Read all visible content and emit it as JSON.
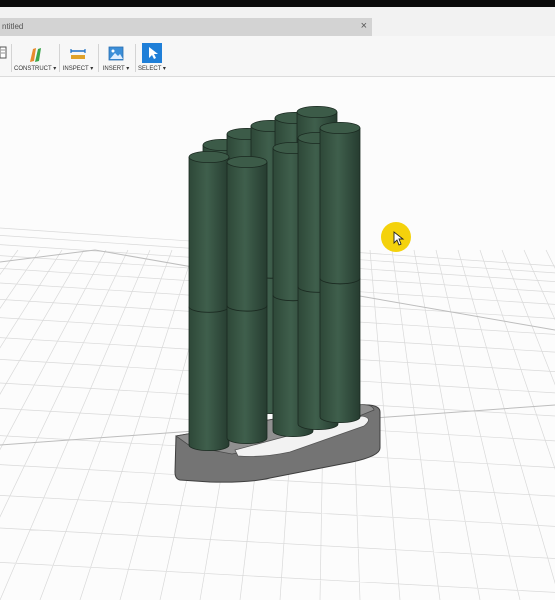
{
  "window": {
    "tab_title": "ntitled",
    "close_glyph": "×"
  },
  "toolbar": {
    "construct_label": "CONSTRUCT ▾",
    "inspect_label": "INSPECT ▾",
    "insert_label": "INSERT ▾",
    "select_label": "SELECT ▾"
  },
  "icons": [
    "document-icon",
    "construct-icon",
    "inspect-icon",
    "insert-icon",
    "select-icon",
    "cursor-icon"
  ],
  "colors": {
    "cylinder_green": "#3c5b48",
    "tray_gray": "#6c6c6c",
    "select_blue": "#1f7fd8",
    "cursor_highlight": "#f4d20c"
  }
}
